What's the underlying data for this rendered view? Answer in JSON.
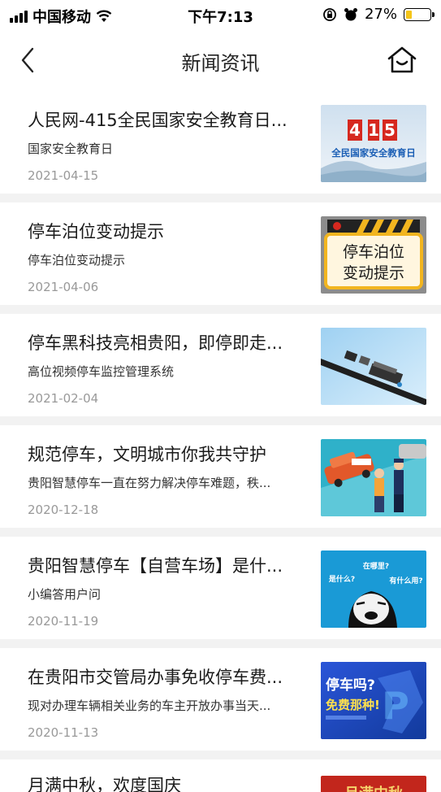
{
  "status_bar": {
    "carrier": "中国移动",
    "time": "下午7:13",
    "battery_percent": "27%",
    "battery_level": 0.27,
    "battery_color": "#f5c518"
  },
  "navbar": {
    "title": "新闻资讯",
    "back_icon": "chevron-left-icon",
    "home_icon": "home-icon"
  },
  "news": [
    {
      "title": "人民网-415全民国家安全教育日...",
      "subtitle": "国家安全教育日",
      "date": "2021-04-15",
      "thumb": {
        "icon": "security-day-thumbnail",
        "big_text": "4·15",
        "caption": "全民国家安全教育日"
      }
    },
    {
      "title": "停车泊位变动提示",
      "subtitle": "停车泊位变动提示",
      "date": "2021-04-06",
      "thumb": {
        "icon": "parking-notice-thumbnail",
        "line1": "停车泊位",
        "line2": "变动提示"
      }
    },
    {
      "title": "停车黑科技亮相贵阳，即停即走...",
      "subtitle": "高位视频停车监控管理系统",
      "date": "2021-02-04",
      "thumb": {
        "icon": "camera-pole-thumbnail"
      }
    },
    {
      "title": "规范停车，文明城市你我共守护",
      "subtitle": "贵阳智慧停车一直在努力解决停车难题，秩...",
      "date": "2020-12-18",
      "thumb": {
        "icon": "parking-warden-thumbnail"
      }
    },
    {
      "title": "贵阳智慧停车【自营车场】是什...",
      "subtitle": "小编答用户问",
      "date": "2020-11-19",
      "thumb": {
        "icon": "meme-questions-thumbnail",
        "q1": "在哪里?",
        "q2": "是什么?",
        "q3": "有什么用?"
      }
    },
    {
      "title": "在贵阳市交管局办事免收停车费...",
      "subtitle": "现对办理车辆相关业务的车主开放办事当天...",
      "date": "2020-11-13",
      "thumb": {
        "icon": "free-parking-thumbnail",
        "line1": "停车吗?",
        "line2": "免费那种!"
      }
    },
    {
      "title": "月满中秋，欢度国庆",
      "subtitle": "",
      "date": "",
      "thumb": {
        "icon": "festival-thumbnail",
        "text": "月满中秋"
      }
    }
  ]
}
